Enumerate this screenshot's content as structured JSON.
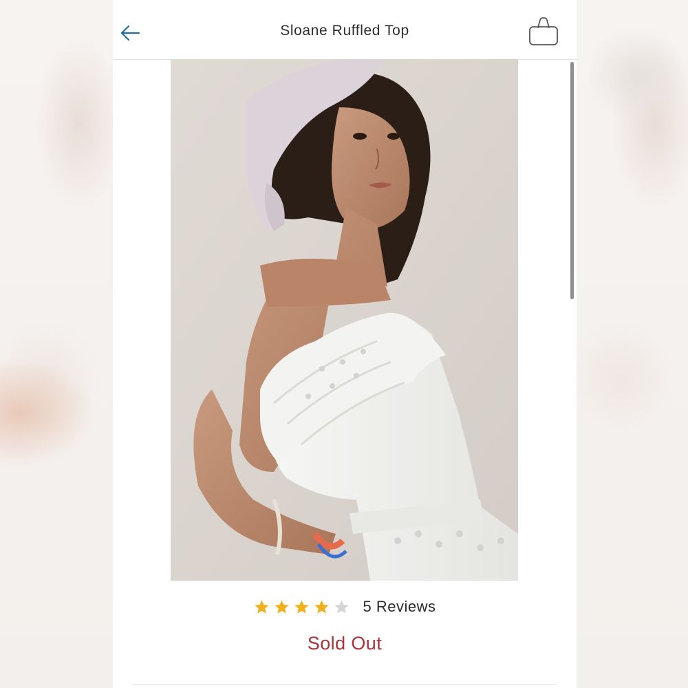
{
  "header": {
    "title": "Sloane Ruffled Top",
    "back_icon": "arrow-left-icon",
    "bag_icon": "shopping-bag-icon"
  },
  "product": {
    "image_label": "model wearing white ruffled strapless top"
  },
  "rating": {
    "stars": 4,
    "max_stars": 5,
    "reviews_label": "5 Reviews"
  },
  "availability": {
    "status": "Sold Out"
  },
  "colors": {
    "accent": "#1f6f9a",
    "star_filled": "#f2b01e",
    "star_empty": "#d6d6d6",
    "sold_out": "#a6343a"
  }
}
